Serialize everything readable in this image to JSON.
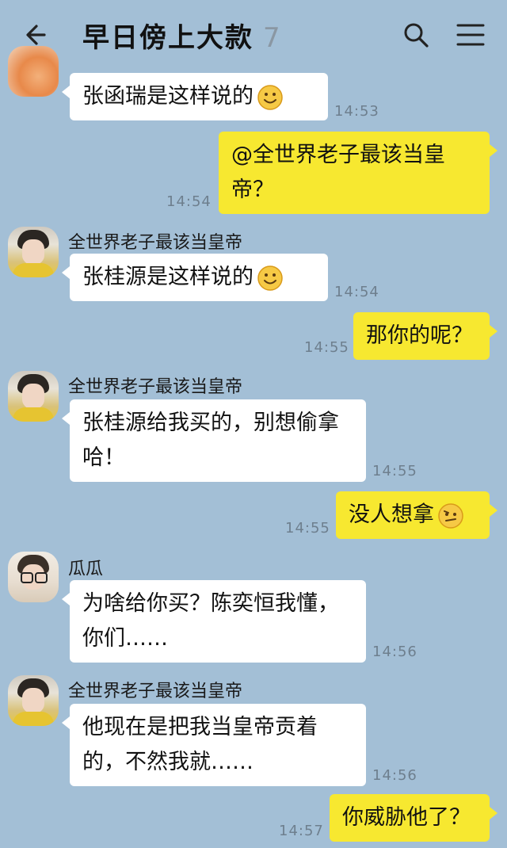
{
  "header": {
    "title": "早日傍上大款",
    "member_count": "7",
    "back_icon": "arrow-left-icon",
    "search_icon": "search-icon",
    "menu_icon": "menu-icon"
  },
  "messages": [
    {
      "side": "in",
      "sender": "",
      "text": "张函瑞是这样说的",
      "emoji": "smile",
      "time": "14:53"
    },
    {
      "side": "out",
      "text": "@全世界老子最该当皇帝？",
      "time": "14:54"
    },
    {
      "side": "in",
      "sender": "全世界老子最该当皇帝",
      "text": "张桂源是这样说的",
      "emoji": "smile",
      "time": "14:54"
    },
    {
      "side": "out",
      "text": "那你的呢？",
      "time": "14:55"
    },
    {
      "side": "in",
      "sender": "全世界老子最该当皇帝",
      "text": "张桂源给我买的，别想偷拿哈！",
      "time": "14:55"
    },
    {
      "side": "out",
      "text": "没人想拿",
      "emoji": "confused",
      "time": "14:55"
    },
    {
      "side": "in",
      "sender": "瓜瓜",
      "text": "为啥给你买？陈奕恒我懂，你们……",
      "time": "14:56"
    },
    {
      "side": "in",
      "sender": "全世界老子最该当皇帝",
      "text": "他现在是把我当皇帝贡着的，不然我就……",
      "time": "14:56"
    },
    {
      "side": "out",
      "text": "你威胁他了？",
      "time": "14:57"
    }
  ],
  "colors": {
    "background": "#a3bfd6",
    "incoming_bubble": "#ffffff",
    "outgoing_bubble": "#f7e830"
  }
}
